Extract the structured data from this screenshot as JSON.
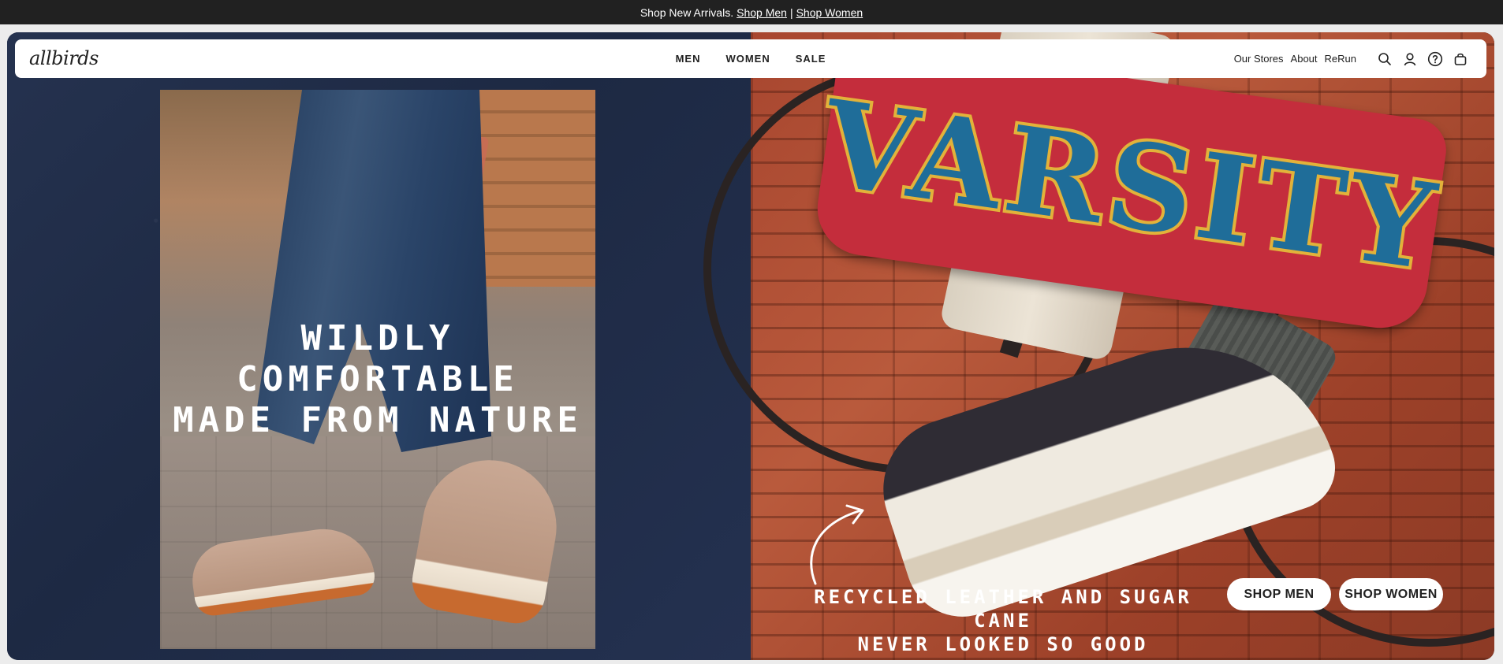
{
  "announcement": {
    "prefix": "Shop New Arrivals.",
    "link_men": "Shop Men",
    "separator": "|",
    "link_women": "Shop Women"
  },
  "header": {
    "logo": "allbirds",
    "nav": [
      "MEN",
      "WOMEN",
      "SALE"
    ],
    "right_links": [
      "Our Stores",
      "About",
      "ReRun"
    ],
    "icons": [
      "search-icon",
      "account-icon",
      "help-icon",
      "cart-icon"
    ]
  },
  "hero": {
    "left_headline_line1": "WILDLY COMFORTABLE",
    "left_headline_line2": "MADE FROM NATURE",
    "patch_text": "VARSITY",
    "tagline_line1": "RECYCLED LEATHER AND SUGAR CANE",
    "tagline_line2": "NEVER LOOKED SO GOOD",
    "cta_men": "SHOP MEN",
    "cta_women": "SHOP WOMEN"
  },
  "colors": {
    "announce_bg": "#212121",
    "left_bg": "#1f2b45",
    "patch_red": "#c42d3c",
    "patch_blue": "#1f6d99",
    "patch_gold": "#e2b23a",
    "brick": "#a8462f"
  }
}
